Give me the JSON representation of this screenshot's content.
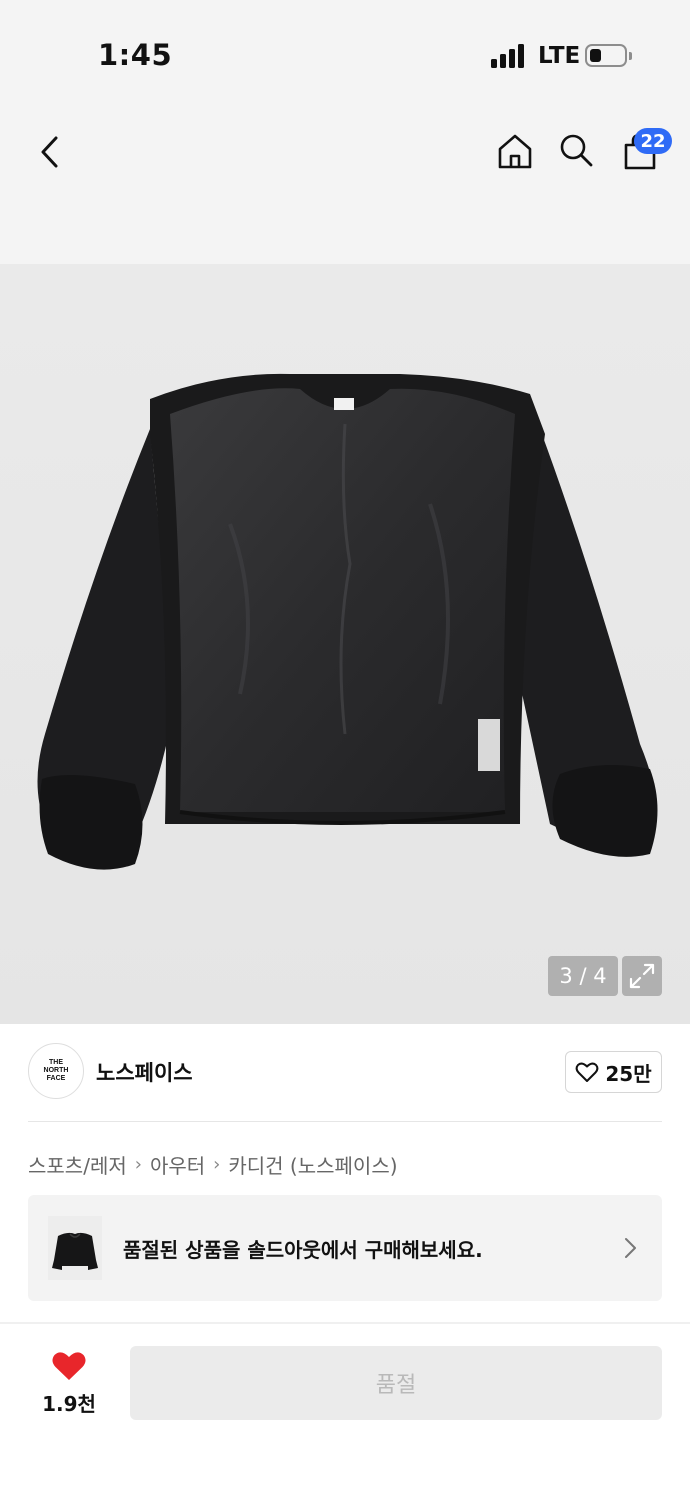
{
  "status_bar": {
    "time": "1:45",
    "network": "LTE"
  },
  "header": {
    "back_icon": "chevron-left-icon",
    "home_icon": "home-icon",
    "search_icon": "search-icon",
    "bag_icon": "shopping-bag-icon",
    "bag_count": "22",
    "badge_color": "#2f6bf6"
  },
  "gallery": {
    "counter": "3 / 4",
    "expand_icon": "expand-icon"
  },
  "brand": {
    "logo_lines": [
      "THE",
      "NORTH",
      "FACE"
    ],
    "name": "노스페이스",
    "like_count": "25만"
  },
  "breadcrumb": [
    "스포츠/레저",
    "아우터",
    "카디건 (노스페이스)"
  ],
  "soldout_banner": {
    "text": "품절된 상품을 솔드아웃에서 구매해보세요."
  },
  "bottom_bar": {
    "wish_count": "1.9천",
    "wish_color": "#e8262b",
    "purchase_label": "품절"
  }
}
